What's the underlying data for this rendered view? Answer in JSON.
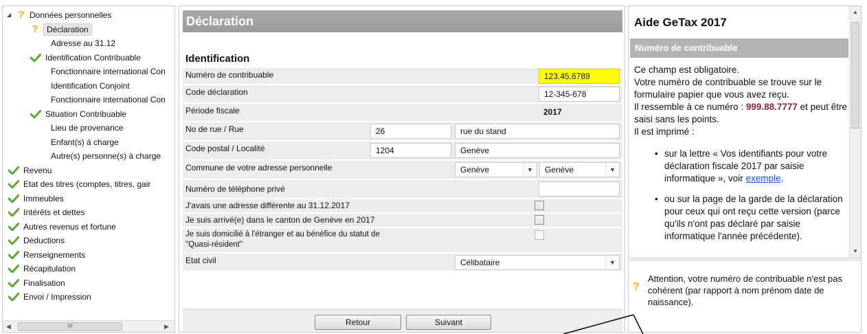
{
  "tree": {
    "items": [
      {
        "label": "Données personnelles",
        "icon": "question-icon",
        "expander": true
      },
      {
        "label": "Déclaration",
        "icon": "question-icon",
        "selected": true
      },
      {
        "label": "Adresse au 31.12",
        "icon": ""
      },
      {
        "label": "Identification Contribuable",
        "icon": "check-icon"
      },
      {
        "label": "Fonctionnaire international Con",
        "icon": ""
      },
      {
        "label": "Identification Conjoint",
        "icon": ""
      },
      {
        "label": "Fonctionnaire international Con",
        "icon": ""
      },
      {
        "label": "Situation Contribuable",
        "icon": "check-icon"
      },
      {
        "label": "Lieu de provenance",
        "icon": ""
      },
      {
        "label": "Enfant(s) à charge",
        "icon": ""
      },
      {
        "label": "Autre(s) personne(s) à charge",
        "icon": ""
      },
      {
        "label": "Revenu",
        "icon": "check-icon"
      },
      {
        "label": "Etat des titres (comptes, titres, gair",
        "icon": "check-icon"
      },
      {
        "label": "Immeubles",
        "icon": "check-icon"
      },
      {
        "label": "Intérêts et dettes",
        "icon": "check-icon"
      },
      {
        "label": "Autres revenus et fortune",
        "icon": "check-icon"
      },
      {
        "label": "Déductions",
        "icon": "check-icon"
      },
      {
        "label": "Renseignements",
        "icon": "check-icon"
      },
      {
        "label": "Récapitulation",
        "icon": "check-icon"
      },
      {
        "label": "Finalisation",
        "icon": "check-icon"
      },
      {
        "label": "Envoi / Impression",
        "icon": "check-icon"
      }
    ],
    "scroll_thumb": "III"
  },
  "form": {
    "header": "Déclaration",
    "section": "Identification",
    "rows": {
      "numero": {
        "label": "Numéro de contribuable",
        "value": "123.45.6789"
      },
      "code": {
        "label": "Code déclaration",
        "value": "12-345-678"
      },
      "periode": {
        "label": "Période fiscale",
        "value": "2017"
      },
      "rue": {
        "label": "No de rue / Rue",
        "no": "26",
        "rue": "rue du stand"
      },
      "postal": {
        "label": "Code postal / Localité",
        "code": "1204",
        "localite": "Genève"
      },
      "commune": {
        "label": "Commune de votre adresse personnelle",
        "value1": "Genève",
        "value2": "Genève"
      },
      "tel": {
        "label": "Numéro de téléphone privé",
        "value": ""
      },
      "adresse_diff": {
        "label": "J'avais une adresse différente au 31.12.2017"
      },
      "arrive": {
        "label": "Je suis arrivé(e) dans le canton de Genève en 2017"
      },
      "quasi_line1": "Je suis domicilié à l'étranger et au bénéfice du statut de",
      "quasi_line2": "\"Quasi-résident\"",
      "etat": {
        "label": "Etat civil",
        "value": "Célibataire"
      }
    },
    "buttons": {
      "retour": "Retour",
      "suivant": "Suivant"
    }
  },
  "help": {
    "title": "Aide GeTax 2017",
    "band": "Numéro de contribuable",
    "p1": "Ce champ est obligatoire.",
    "p2": "Votre numéro de contribuable se trouve sur le formulaire papier que vous avez reçu.",
    "p3a": "Il ressemble à ce numéro : ",
    "p3num": "999.88.7777",
    "p3b": " et peut être saisi sans les points.",
    "p4": "Il est imprimé :",
    "bullet1a": "sur la lettre « Vos identifiants pour votre déclaration fiscale 2017 par saisie informatique », voir ",
    "bullet1link": "exemple",
    "bullet1b": ".",
    "bullet2": "ou sur la page de la garde de la déclaration pour ceux qui ont reçu cette version (parce qu'ils n'ont pas déclaré par saisie informatique l'année précédente)."
  },
  "warning": {
    "text": "Attention, votre numéro de contribuable n'est pas cohérent (par rapport à nom prénom date de naissance)."
  },
  "colors": {
    "yellow_field": "#ffff00",
    "check_green": "#5aa82c",
    "question_yellow": "#f2b300",
    "header_gray": "#a0a0a0"
  }
}
